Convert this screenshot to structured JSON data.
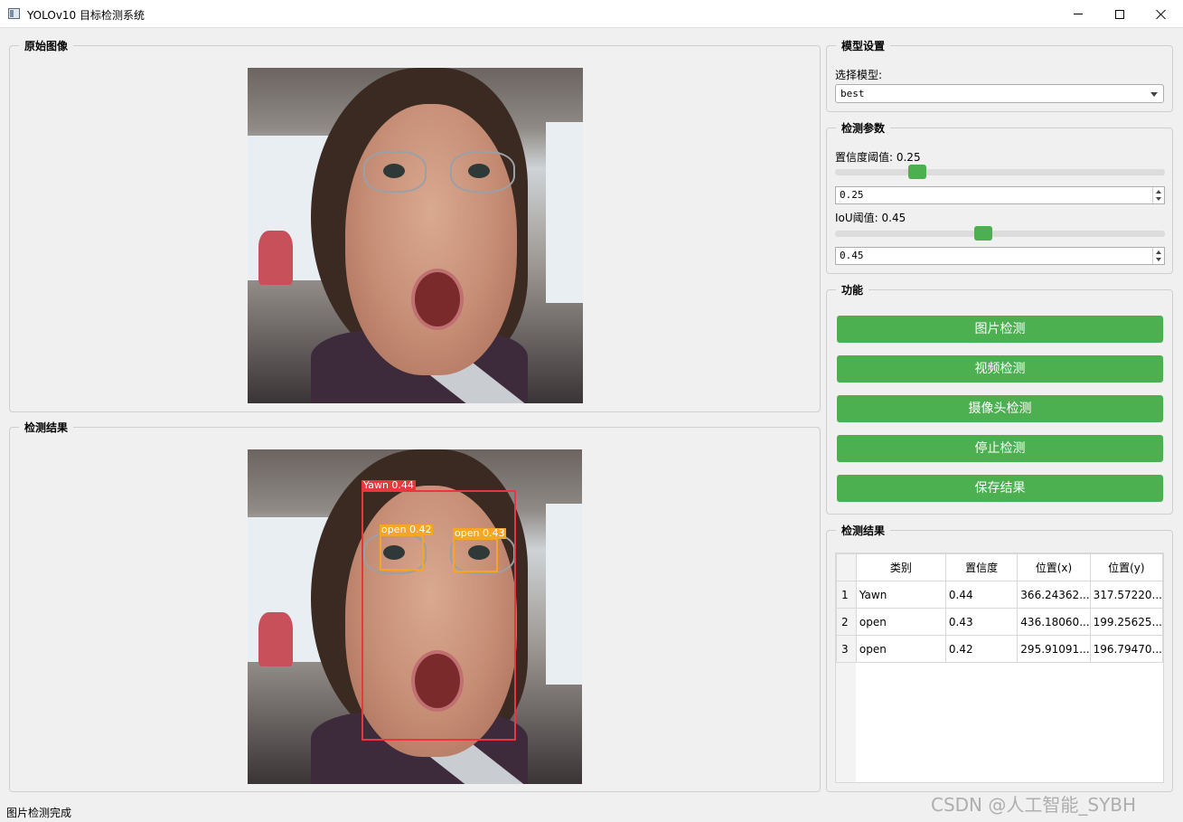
{
  "window": {
    "title": "YOLOv10 目标检测系统"
  },
  "groups": {
    "original": "原始图像",
    "result_image": "检测结果",
    "model_settings": "模型设置",
    "detect_params": "检测参数",
    "functions": "功能",
    "result_table": "检测结果"
  },
  "model": {
    "label": "选择模型:",
    "selected": "best"
  },
  "params": {
    "conf_label": "置信度阈值: 0.25",
    "conf_value": "0.25",
    "conf_level": 0.25,
    "iou_label": "IoU阈值: 0.45",
    "iou_value": "0.45",
    "iou_level": 0.45
  },
  "buttons": {
    "image_detect": "图片检测",
    "video_detect": "视频检测",
    "camera_detect": "摄像头检测",
    "stop_detect": "停止检测",
    "save_result": "保存结果"
  },
  "detections": [
    {
      "label": "Yawn 0.44",
      "color": "#e8383d"
    },
    {
      "label": "open 0.42",
      "color": "#f5a623"
    },
    {
      "label": "open 0.43",
      "color": "#f5a623"
    }
  ],
  "table": {
    "headers": [
      "类别",
      "置信度",
      "位置(x)",
      "位置(y)"
    ],
    "rows": [
      {
        "index": "1",
        "cls": "Yawn",
        "conf": "0.44",
        "x": "366.24362...",
        "y": "317.57220..."
      },
      {
        "index": "2",
        "cls": "open",
        "conf": "0.43",
        "x": "436.18060...",
        "y": "199.25625..."
      },
      {
        "index": "3",
        "cls": "open",
        "conf": "0.42",
        "x": "295.91091...",
        "y": "196.79470..."
      }
    ]
  },
  "status": {
    "message": "图片检测完成"
  },
  "watermark": "CSDN @人工智能_SYBH"
}
